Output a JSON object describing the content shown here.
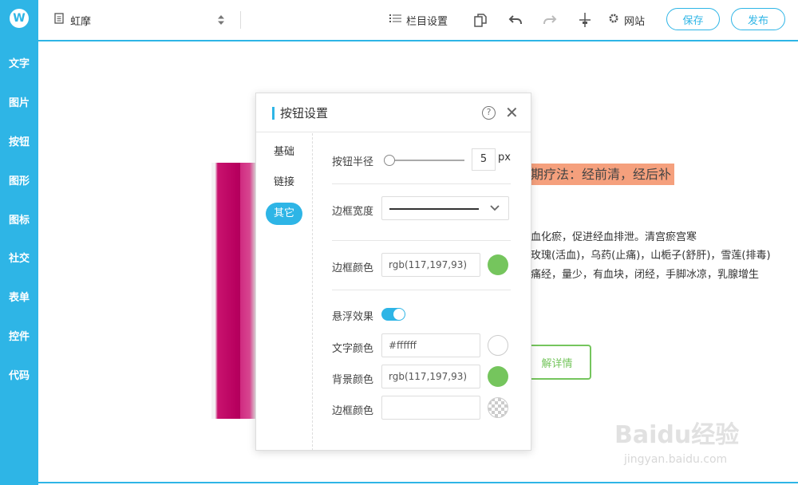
{
  "sidebar": {
    "logo": "W",
    "items": [
      {
        "label": "文字"
      },
      {
        "label": "图片"
      },
      {
        "label": "按钮"
      },
      {
        "label": "图形"
      },
      {
        "label": "图标"
      },
      {
        "label": "社交"
      },
      {
        "label": "表单"
      },
      {
        "label": "控件"
      },
      {
        "label": "代码"
      }
    ]
  },
  "header": {
    "page_title": "虹摩",
    "column_settings": "栏目设置",
    "website": "网站",
    "save": "保存",
    "publish": "发布",
    "icons": [
      "page-icon",
      "sort-arrows-icon",
      "list-icon",
      "copy-icon",
      "undo-icon",
      "redo-icon",
      "split-icon",
      "gear-icon"
    ]
  },
  "content": {
    "headline": "期疗法：经前清，经后补",
    "lines": [
      "血化瘀，促进经血排泄。清宫瘀宫寒",
      "玫瑰(活血)，乌药(止痛)，山栀子(舒肝)，雪莲(排毒)",
      "痛经，量少，有血块，闭经，手脚冰凉，乳腺增生"
    ],
    "button_text": "解详情"
  },
  "dialog": {
    "title": "按钮设置",
    "help": "?",
    "close": "✕",
    "tabs": [
      {
        "label": "基础",
        "active": false
      },
      {
        "label": "链接",
        "active": false
      },
      {
        "label": "其它",
        "active": true
      }
    ],
    "button_radius": {
      "label": "按钮半径",
      "value": "5",
      "unit": "px"
    },
    "border_width": {
      "label": "边框宽度"
    },
    "border_color": {
      "label": "边框颜色",
      "value": "rgb(117,197,93)",
      "swatch": "#75c55d"
    },
    "hover": {
      "label": "悬浮效果",
      "enabled": true,
      "text_color": {
        "label": "文字颜色",
        "value": "#ffffff",
        "swatch": "#ffffff"
      },
      "bg_color": {
        "label": "背景颜色",
        "value": "rgb(117,197,93)",
        "swatch": "#75c55d"
      },
      "border_color": {
        "label": "边框颜色",
        "value": "",
        "swatch": "transparent"
      }
    }
  },
  "watermark": {
    "logo": "Baidu经验",
    "url": "jingyan.baidu.com"
  },
  "colors": {
    "accent": "#2eb5e6",
    "green": "#75c55d",
    "highlight": "#f5a07d"
  }
}
